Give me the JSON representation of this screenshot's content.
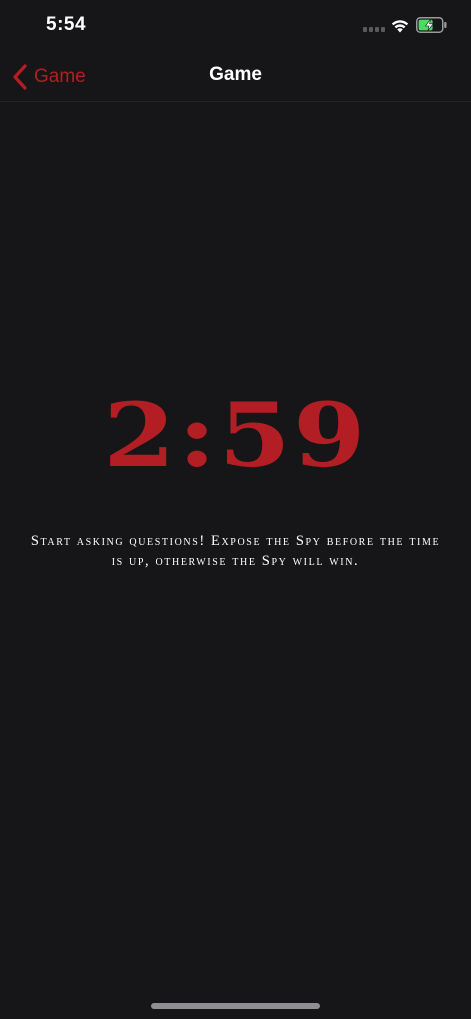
{
  "status_bar": {
    "time": "5:54"
  },
  "nav": {
    "back_label": "Game",
    "title": "Game"
  },
  "timer": {
    "value": "2:59"
  },
  "message": "Start asking questions! Expose the Spy before the time is up, otherwise the Spy will win.",
  "colors": {
    "accent": "#b21e23",
    "background": "#161618",
    "battery_fill": "#4cd964"
  },
  "icons": {
    "back": "chevron-left-icon",
    "signal": "cellular-signal-icon",
    "wifi": "wifi-icon",
    "battery": "battery-charging-icon"
  }
}
